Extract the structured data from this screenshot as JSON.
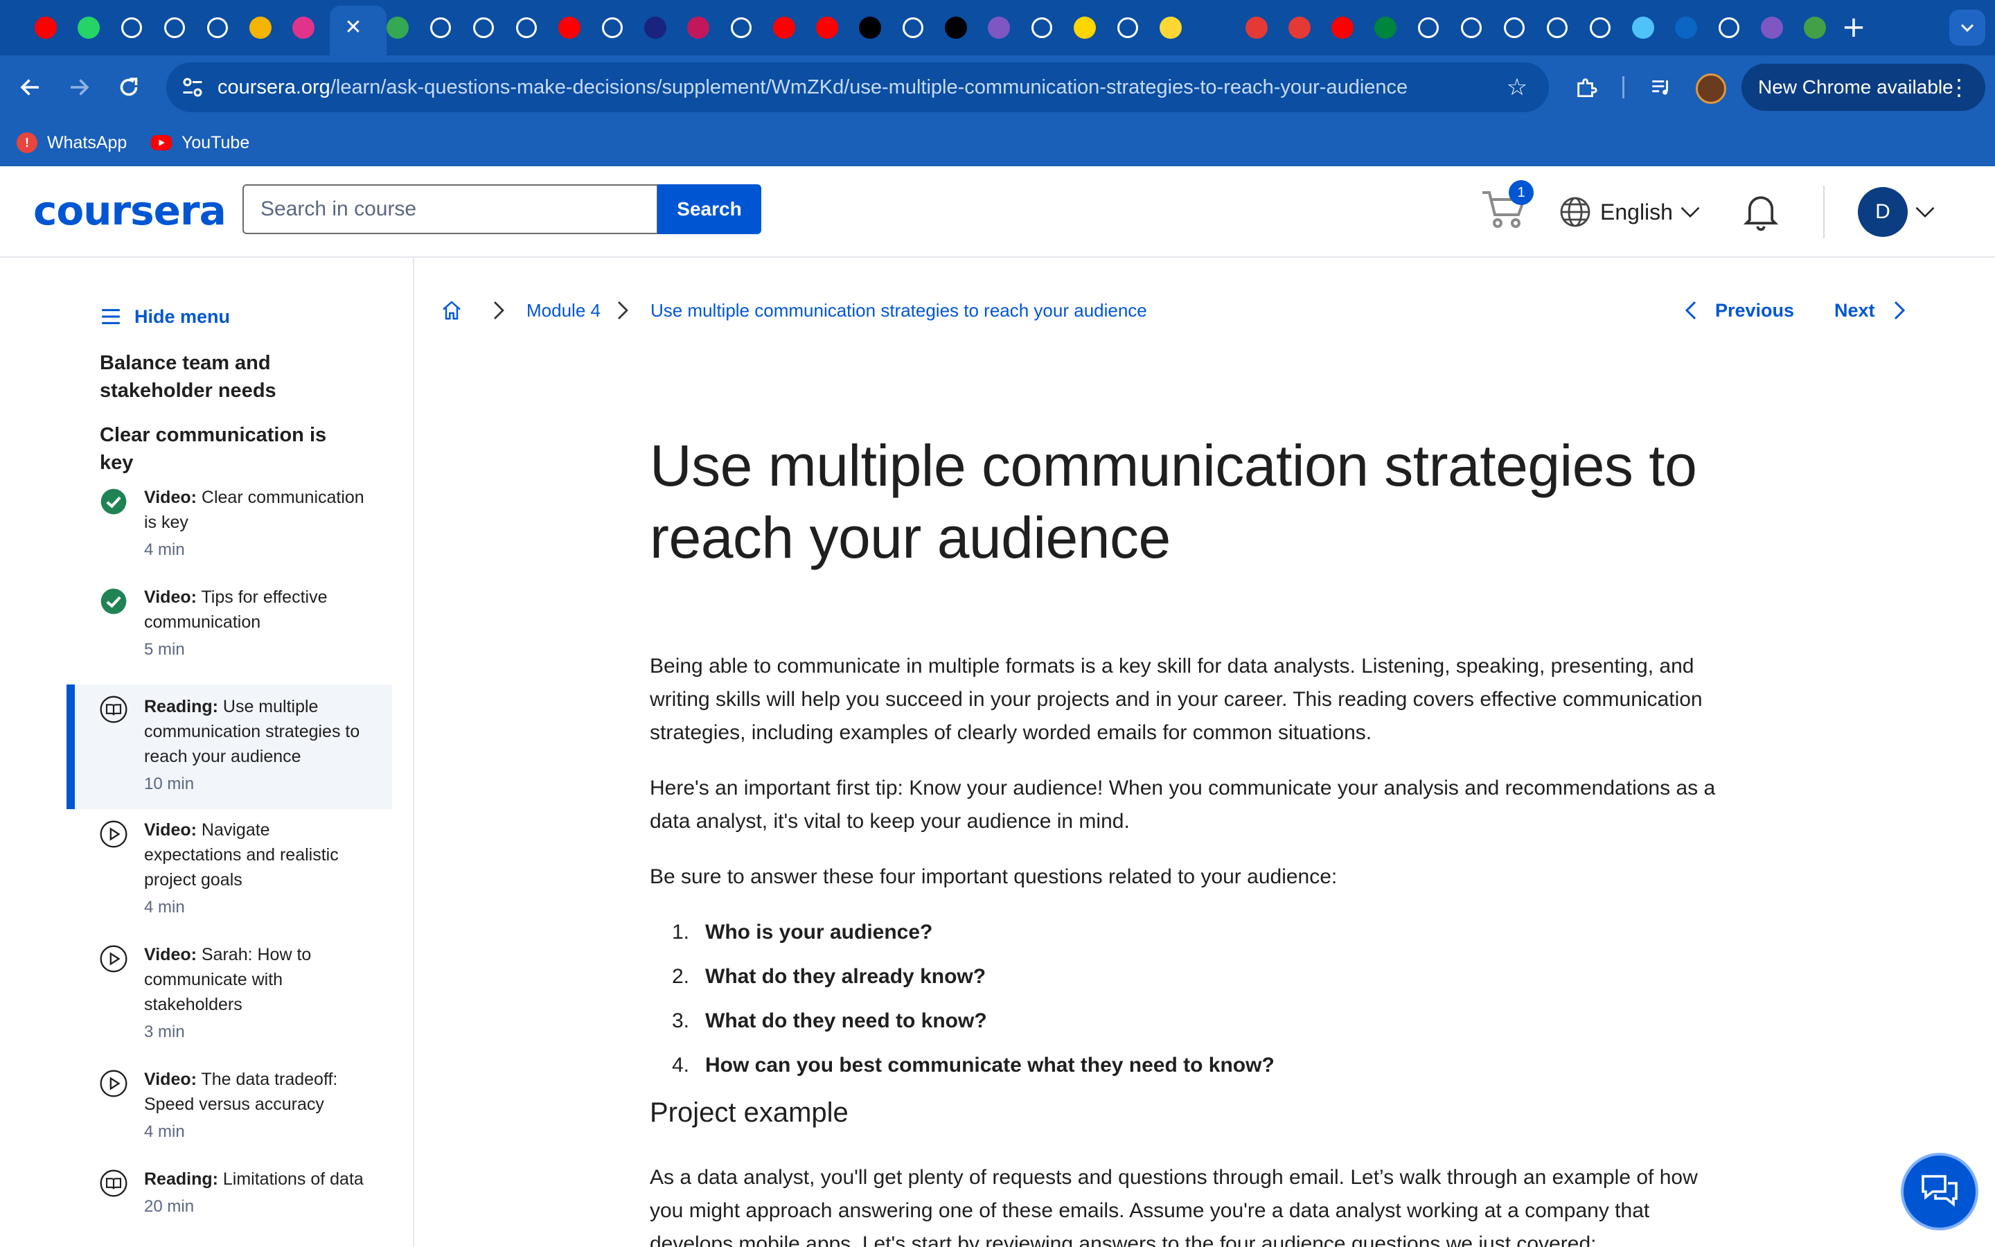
{
  "browser": {
    "tab_favicons": [
      {
        "name": "youtube-favicon",
        "color": "#ff0000"
      },
      {
        "name": "whatsapp-favicon",
        "color": "#25d366"
      },
      {
        "name": "loading-favicon",
        "color": "#ffffff"
      },
      {
        "name": "loading-favicon",
        "color": "#ffffff"
      },
      {
        "name": "github-favicon",
        "color": "#ffffff"
      },
      {
        "name": "google-slides-favicon",
        "color": "#f4b400"
      },
      {
        "name": "app-favicon",
        "color": "#e0338c"
      },
      {
        "name": "google-sheets-favicon",
        "color": "#34a853"
      },
      {
        "name": "k-favicon",
        "color": "#ffffff"
      },
      {
        "name": "globe-favicon",
        "color": "#ffffff"
      },
      {
        "name": "coursera-favicon",
        "color": "#ffffff"
      },
      {
        "name": "youtube-favicon",
        "color": "#ff0000"
      },
      {
        "name": "app-favicon",
        "color": "#ffffff"
      },
      {
        "name": "app-favicon",
        "color": "#1a237e"
      },
      {
        "name": "m-favicon",
        "color": "#c2185b"
      },
      {
        "name": "audio-favicon",
        "color": "#ffffff"
      },
      {
        "name": "youtube-favicon",
        "color": "#ff0000"
      },
      {
        "name": "youtube-favicon",
        "color": "#ff0000"
      },
      {
        "name": "app-favicon",
        "color": "#000000"
      },
      {
        "name": "loading-favicon",
        "color": "#ffffff"
      },
      {
        "name": "app-favicon",
        "color": "#000000"
      },
      {
        "name": "video-favicon",
        "color": "#7e57c2"
      },
      {
        "name": "app-favicon",
        "color": "#ffffff"
      },
      {
        "name": "b-favicon",
        "color": "#ffd600"
      },
      {
        "name": "google-favicon",
        "color": "#ffffff"
      },
      {
        "name": "app-favicon",
        "color": "#fdd835"
      },
      {
        "name": "app-favicon",
        "color": "#0b4ea2"
      },
      {
        "name": "red-ball-favicon",
        "color": "#e53935"
      },
      {
        "name": "red-ball-favicon",
        "color": "#e53935"
      },
      {
        "name": "youtube-favicon",
        "color": "#ff0000"
      },
      {
        "name": "my-unt-favicon",
        "color": "#00853e"
      },
      {
        "name": "coursera-favicon",
        "color": "#ffffff"
      },
      {
        "name": "coursera-favicon",
        "color": "#ffffff"
      },
      {
        "name": "coursera-favicon",
        "color": "#ffffff"
      },
      {
        "name": "chatgpt-favicon",
        "color": "#ffffff"
      },
      {
        "name": "github-favicon",
        "color": "#ffffff"
      },
      {
        "name": "maps-favicon",
        "color": "#4fc3f7"
      },
      {
        "name": "linkedin-favicon",
        "color": "#0a66c2"
      },
      {
        "name": "loading-favicon",
        "color": "#ffffff"
      },
      {
        "name": "app-favicon",
        "color": "#7e57c2"
      },
      {
        "name": "app-favicon",
        "color": "#43a047"
      }
    ],
    "active_tab_close": "✕",
    "new_tab": "+",
    "url_host": "coursera.org",
    "url_path": "/learn/ask-questions-make-decisions/supplement/WmZKd/use-multiple-communication-strategies-to-reach-your-audience",
    "update_chip": "New Chrome available",
    "bookmarks": [
      {
        "label": "WhatsApp",
        "icon": "whatsapp-icon",
        "color": "#e8453c"
      },
      {
        "label": "YouTube",
        "icon": "youtube-icon",
        "color": "#ff0000"
      }
    ]
  },
  "header": {
    "logo": "coursera",
    "search_placeholder": "Search in course",
    "search_button": "Search",
    "cart_count": "1",
    "language": "English",
    "avatar_initial": "D"
  },
  "sidebar": {
    "hide_menu": "Hide menu",
    "section_1": "Balance team and stakeholder needs",
    "section_2": "Clear communication is key",
    "items": [
      {
        "type": "Video:",
        "title": " Clear communication is key",
        "duration": "4 min",
        "icon": "completed-check-icon",
        "active": false
      },
      {
        "type": "Video:",
        "title": " Tips for effective communication",
        "duration": "5 min",
        "icon": "completed-check-icon",
        "active": false
      },
      {
        "type": "Reading:",
        "title": " Use multiple communication strategies to reach your audience",
        "duration": "10 min",
        "icon": "reading-icon",
        "active": true
      },
      {
        "type": "Video:",
        "title": " Navigate expectations and realistic project goals",
        "duration": "4 min",
        "icon": "play-icon",
        "active": false
      },
      {
        "type": "Video:",
        "title": " Sarah: How to communicate with stakeholders",
        "duration": "3 min",
        "icon": "play-icon",
        "active": false
      },
      {
        "type": "Video:",
        "title": " The data tradeoff: Speed versus accuracy",
        "duration": "4 min",
        "icon": "play-icon",
        "active": false
      },
      {
        "type": "Reading:",
        "title": " Limitations of data",
        "duration": "20 min",
        "icon": "reading-icon",
        "active": false
      }
    ]
  },
  "breadcrumb": {
    "module": "Module 4",
    "current": "Use multiple communication strategies to reach your audience",
    "previous": "Previous",
    "next": "Next"
  },
  "article": {
    "title": "Use multiple communication strategies to reach your audience",
    "p1": "Being able to communicate in multiple formats is a key skill for data analysts. Listening, speaking, presenting, and writing skills will help you succeed in your projects and in your career. This reading covers effective communication strategies, including examples of clearly worded emails for common situations.",
    "p2": "Here's an important first tip: Know your audience! When you communicate your analysis and recommendations as a data analyst, it's vital to keep your audience in mind.",
    "p3": "Be sure to answer these four important questions related to your audience:",
    "questions": [
      "Who is your audience?",
      "What do they already know?",
      "What do they need to know?",
      "How can you best communicate what they need to know?"
    ],
    "numbers": [
      "1.",
      "2.",
      "3.",
      "4."
    ],
    "subheading": "Project example",
    "p4": "As a data analyst, you'll get plenty of requests and questions through email. Let’s walk through an example of how you might approach answering one of these emails. Assume you're a data analyst working at a company that develops mobile apps. Let's start by reviewing answers to the four audience questions we just covered:"
  }
}
